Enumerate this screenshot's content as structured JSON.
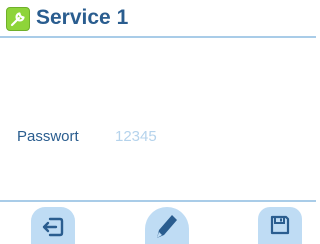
{
  "header": {
    "title": "Service 1",
    "icon": "wrench-icon",
    "accent_color": "#8ed43a",
    "title_color": "#2a5d8f"
  },
  "form": {
    "password_label": "Passwort",
    "password_value": "12345"
  },
  "toolbar": {
    "back": {
      "icon": "back-arrow-icon"
    },
    "edit": {
      "icon": "pencil-icon"
    },
    "save": {
      "icon": "floppy-disk-icon"
    },
    "button_color": "#bfdcf4",
    "icon_color": "#2a5d8f"
  }
}
